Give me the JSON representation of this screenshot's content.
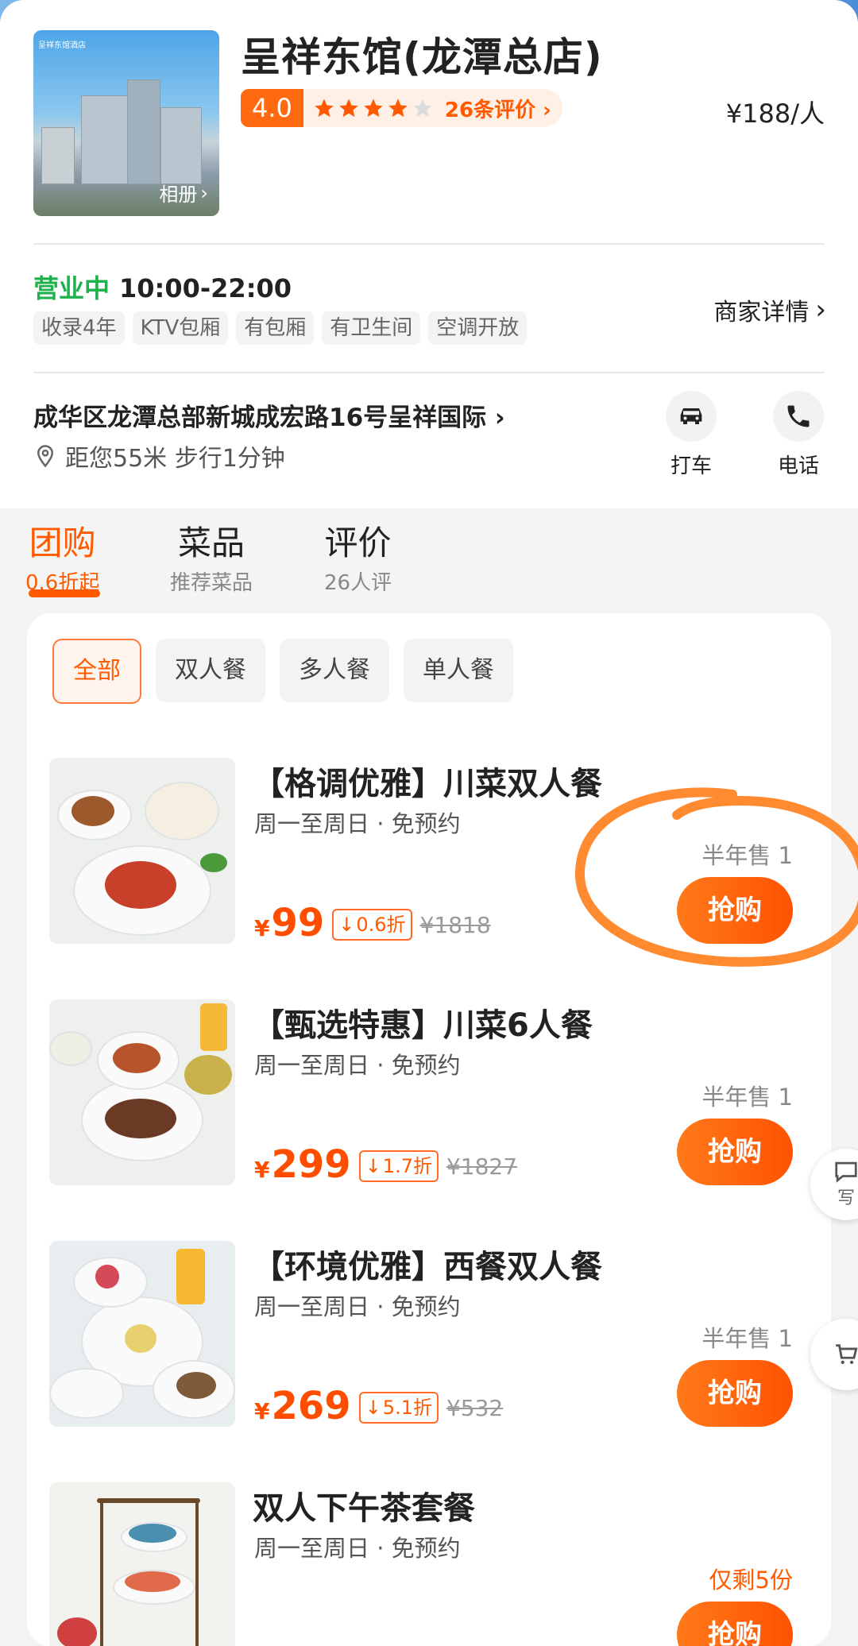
{
  "store": {
    "name": "呈祥东馆(龙潭总店)",
    "score": "4.0",
    "reviews_link": "26条评价",
    "price_per_person": "¥188/人",
    "album_label": "相册",
    "hero_logo_text": "呈祥东馆酒店",
    "open_status": "营业中",
    "hours": "10:00-22:00",
    "tags": [
      "收录4年",
      "KTV包厢",
      "有包厢",
      "有卫生间",
      "空调开放"
    ],
    "merchant_details": "商家详情",
    "address": "成华区龙潭总部新城成宏路16号呈祥国际",
    "distance": "距您55米 步行1分钟",
    "actions": {
      "taxi": "打车",
      "phone": "电话"
    },
    "rating_stars": 4
  },
  "tabs": [
    {
      "label": "团购",
      "sub": "0.6折起"
    },
    {
      "label": "菜品",
      "sub": "推荐菜品"
    },
    {
      "label": "评价",
      "sub": "26人评"
    }
  ],
  "filters": [
    "全部",
    "双人餐",
    "多人餐",
    "单人餐"
  ],
  "deals": [
    {
      "name": "【格调优雅】川菜双人餐",
      "sub": "周一至周日 · 免预约",
      "yen": "¥",
      "price": "99",
      "discount": "0.6折",
      "original": "¥1818",
      "sold": "半年售 1",
      "button": "抢购"
    },
    {
      "name": "【甄选特惠】川菜6人餐",
      "sub": "周一至周日 · 免预约",
      "yen": "¥",
      "price": "299",
      "discount": "1.7折",
      "original": "¥1827",
      "sold": "半年售 1",
      "button": "抢购"
    },
    {
      "name": "【环境优雅】西餐双人餐",
      "sub": "周一至周日 · 免预约",
      "yen": "¥",
      "price": "269",
      "discount": "5.1折",
      "original": "¥532",
      "sold": "半年售 1",
      "button": "抢购"
    },
    {
      "name": "双人下午茶套餐",
      "sub": "周一至周日 · 免预约",
      "sold": "仅剩5份",
      "button": "抢购"
    }
  ],
  "floating": {
    "write": "写"
  },
  "colors": {
    "accent": "#ff5a00",
    "open": "#1fb14e"
  }
}
